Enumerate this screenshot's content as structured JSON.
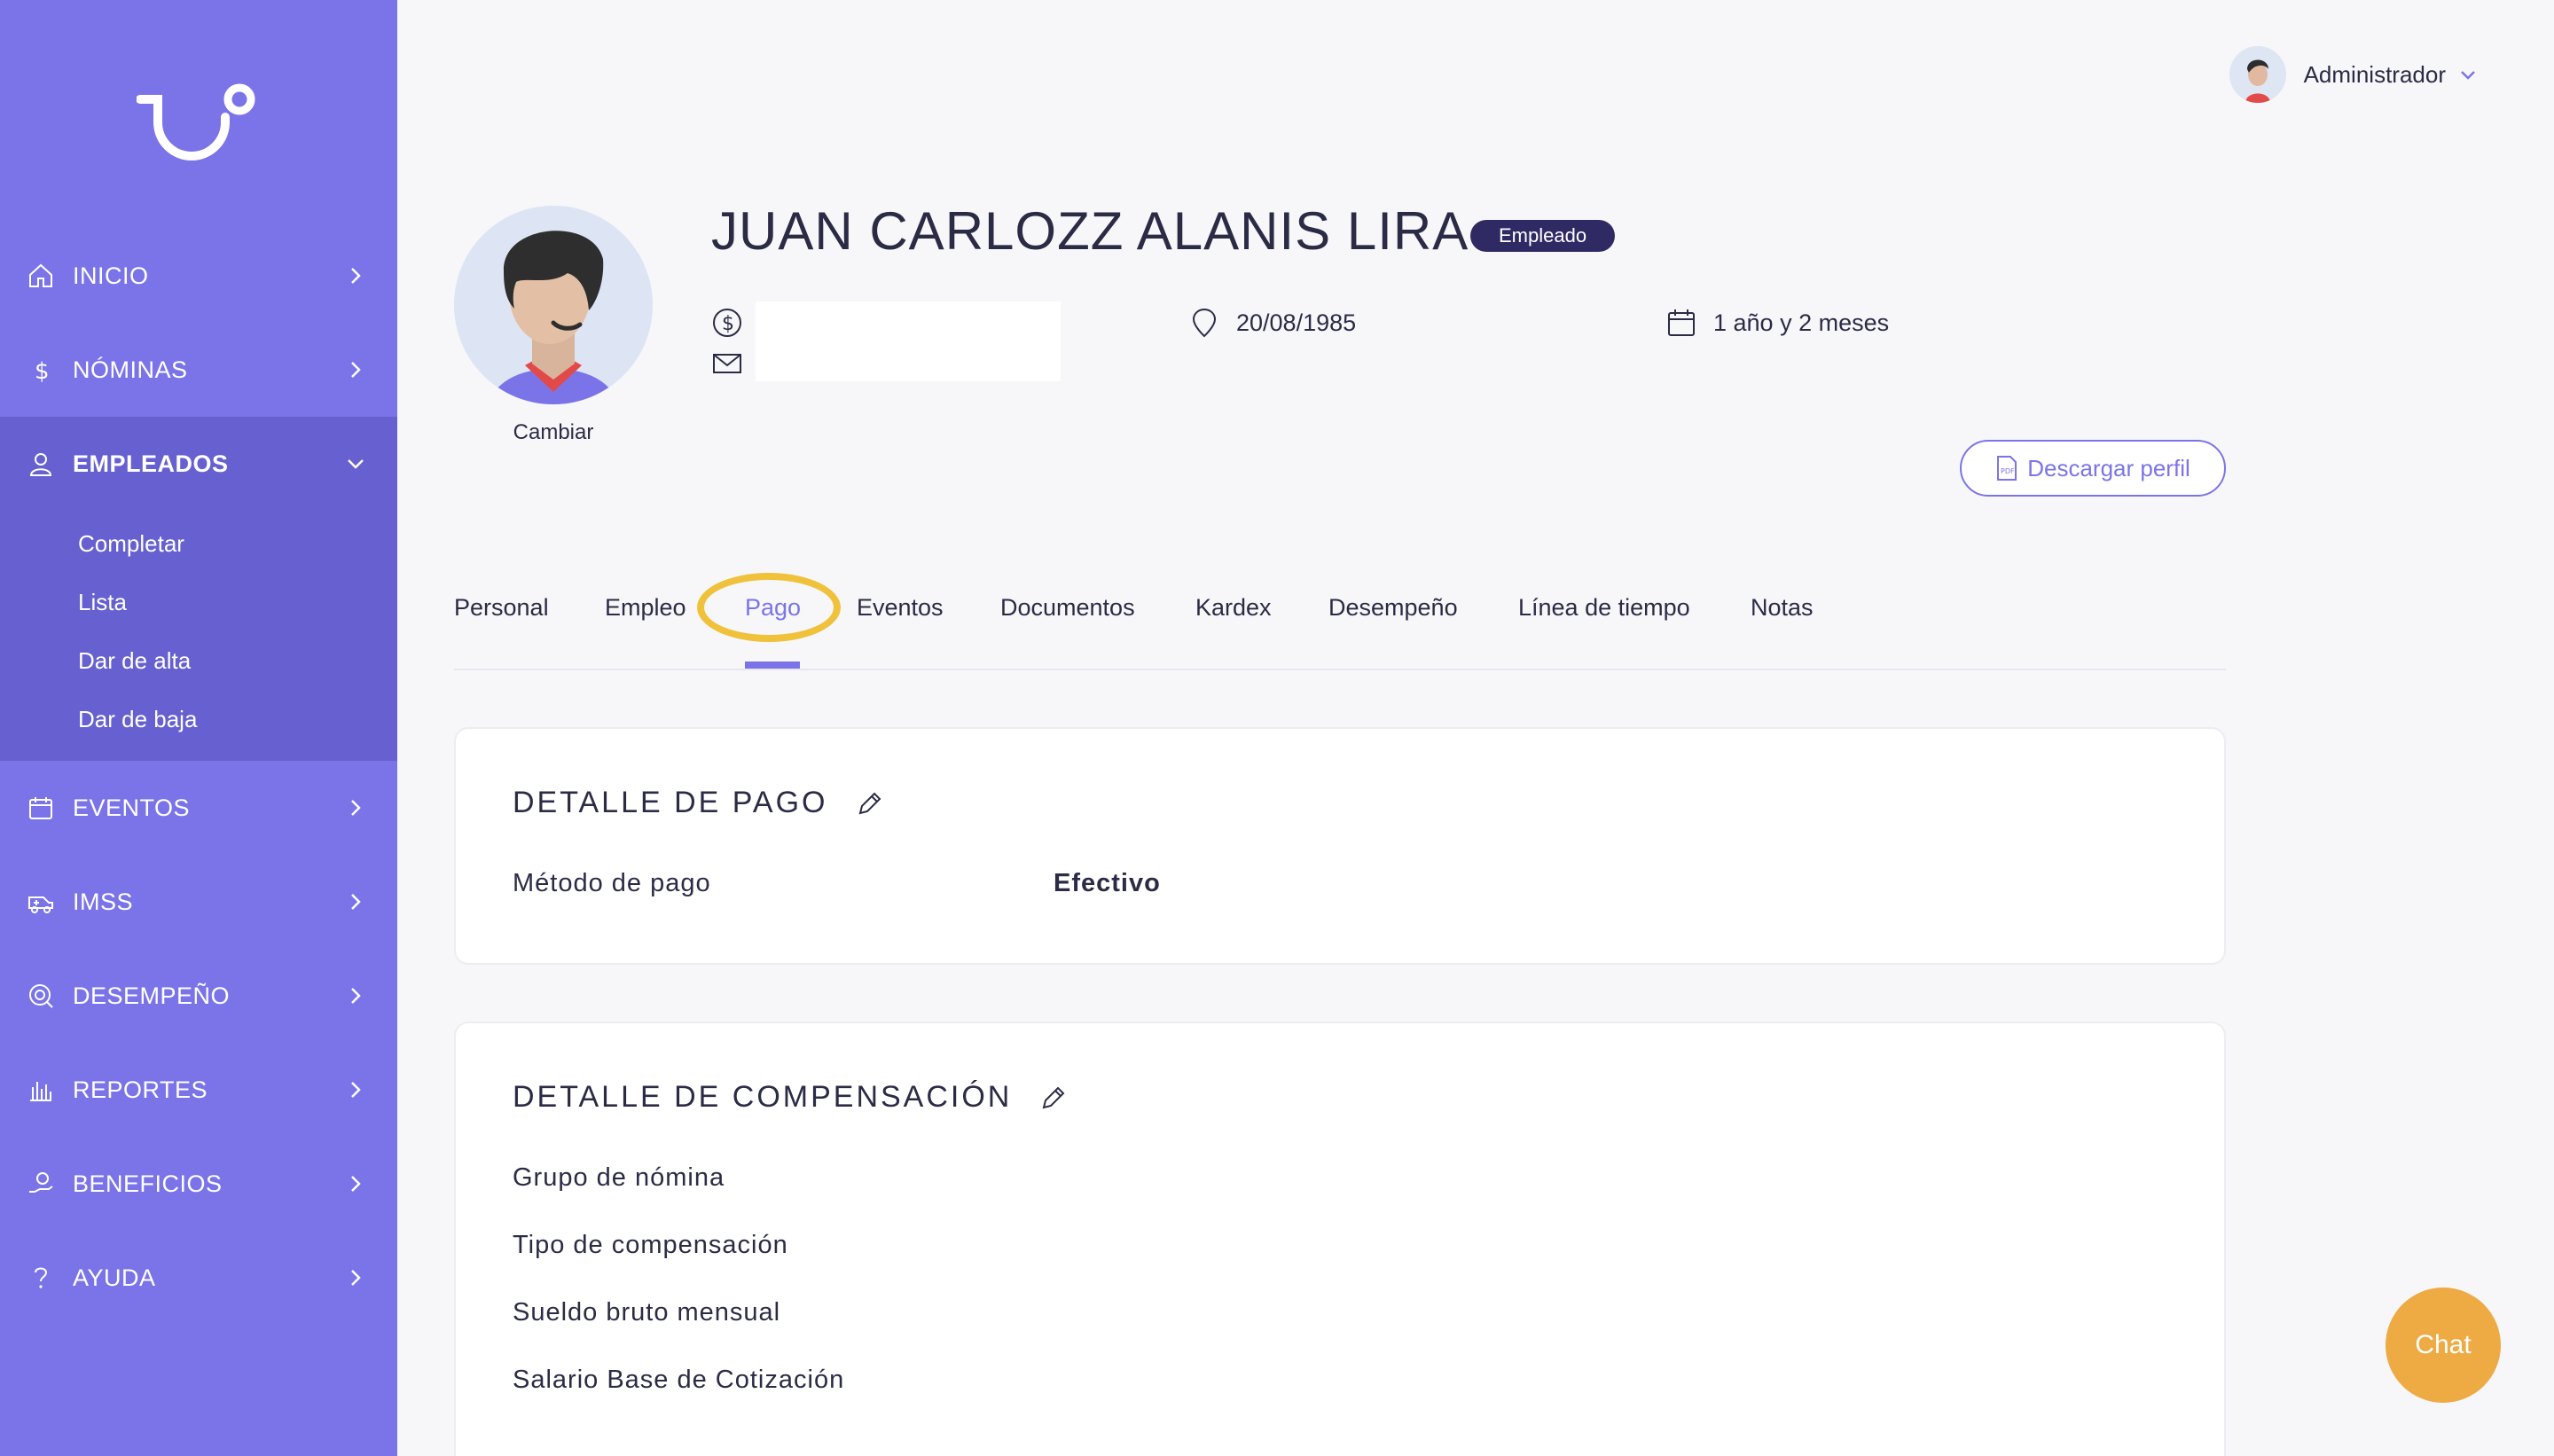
{
  "sidebar": {
    "items": [
      {
        "label": "INICIO",
        "icon": "home-icon"
      },
      {
        "label": "NÓMINAS",
        "icon": "dollar-icon"
      },
      {
        "label": "EMPLEADOS",
        "icon": "user-icon",
        "expanded": true,
        "children": [
          "Completar",
          "Lista",
          "Dar de alta",
          "Dar de baja"
        ]
      },
      {
        "label": "EVENTOS",
        "icon": "calendar-icon"
      },
      {
        "label": "IMSS",
        "icon": "ambulance-icon"
      },
      {
        "label": "DESEMPEÑO",
        "icon": "performance-icon"
      },
      {
        "label": "REPORTES",
        "icon": "bar-chart-icon"
      },
      {
        "label": "BENEFICIOS",
        "icon": "benefits-icon"
      },
      {
        "label": "AYUDA",
        "icon": "help-icon"
      }
    ]
  },
  "header": {
    "user_name": "Administrador"
  },
  "profile": {
    "name": "JUAN CARLOZZ ALANIS LIRA",
    "badge": "Empleado",
    "change_photo": "Cambiar",
    "birthdate": "20/08/1985",
    "seniority": "1 año y 2 meses",
    "download_label": "Descargar perfil"
  },
  "tabs": [
    "Personal",
    "Empleo",
    "Pago",
    "Eventos",
    "Documentos",
    "Kardex",
    "Desempeño",
    "Línea de tiempo",
    "Notas"
  ],
  "active_tab": "Pago",
  "payment": {
    "title": "DETALLE DE PAGO",
    "method_label": "Método de pago",
    "method_value": "Efectivo"
  },
  "compensation": {
    "title": "DETALLE DE COMPENSACIÓN",
    "fields": [
      "Grupo de nómina",
      "Tipo de compensación",
      "Sueldo bruto mensual",
      "Salario Base de Cotización"
    ]
  },
  "chat": {
    "label": "Chat"
  },
  "colors": {
    "sidebar": "#7b74e8",
    "sidebar_active": "#6660d0",
    "accent": "#7b74e8",
    "badge": "#2f2a63",
    "chat": "#eeab44",
    "highlight": "#f0c23b"
  }
}
